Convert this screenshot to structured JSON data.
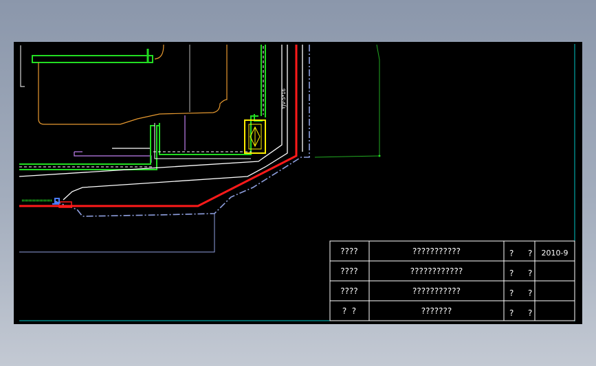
{
  "drawing": {
    "cable_label": "YJV-5*16",
    "colors": {
      "background": "#000000",
      "frame": "#00c8c8",
      "cable": "#ff1a1a",
      "blue_line": "#8fa0e0",
      "green": "#22dd22",
      "orange": "#e89a30",
      "violet": "#c080f0",
      "yellow": "#ffee00",
      "white": "#ffffff"
    }
  },
  "title_block": {
    "rows": [
      {
        "label": "????",
        "value": "???????????",
        "c3": "?",
        "c4": "?",
        "c5": "2010-9"
      },
      {
        "label": "????",
        "value": "????????????",
        "c3": "?",
        "c4": "?",
        "c5": ""
      },
      {
        "label": "????",
        "value": "???????????",
        "c3": "?",
        "c4": "?",
        "c5": ""
      },
      {
        "label": "?  ?",
        "value": "???????",
        "c3": "?",
        "c4": "?",
        "c5": ""
      }
    ]
  }
}
